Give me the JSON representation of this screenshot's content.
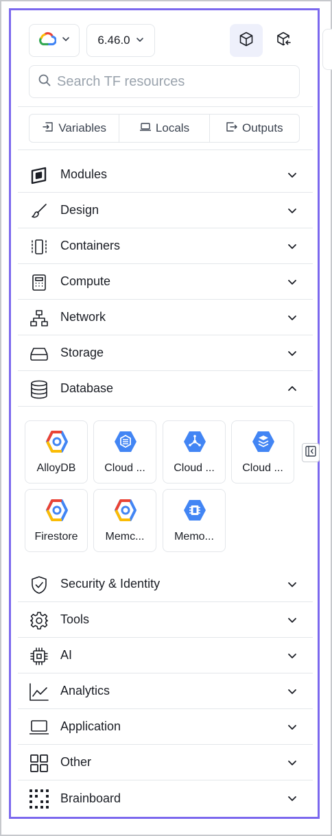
{
  "toolbar": {
    "provider": "google-cloud",
    "version": "6.46.0",
    "resources_view_icon": "cube-icon",
    "import_view_icon": "cube-import-icon"
  },
  "search": {
    "placeholder": "Search TF resources",
    "value": ""
  },
  "tabs": [
    {
      "label": "Variables",
      "icon": "variables-icon"
    },
    {
      "label": "Locals",
      "icon": "laptop-icon"
    },
    {
      "label": "Outputs",
      "icon": "outputs-icon"
    }
  ],
  "categories": [
    {
      "label": "Modules",
      "icon": "modules-icon",
      "expanded": false
    },
    {
      "label": "Design",
      "icon": "brush-icon",
      "expanded": false
    },
    {
      "label": "Containers",
      "icon": "containers-icon",
      "expanded": false
    },
    {
      "label": "Compute",
      "icon": "compute-icon",
      "expanded": false
    },
    {
      "label": "Network",
      "icon": "network-icon",
      "expanded": false
    },
    {
      "label": "Storage",
      "icon": "storage-icon",
      "expanded": false
    },
    {
      "label": "Database",
      "icon": "database-icon",
      "expanded": true
    },
    {
      "label": "Security & Identity",
      "icon": "shield-icon",
      "expanded": false
    },
    {
      "label": "Tools",
      "icon": "gear-icon",
      "expanded": false
    },
    {
      "label": "AI",
      "icon": "chip-icon",
      "expanded": false
    },
    {
      "label": "Analytics",
      "icon": "chart-icon",
      "expanded": false
    },
    {
      "label": "Application",
      "icon": "laptop-icon",
      "expanded": false
    },
    {
      "label": "Other",
      "icon": "grid-icon",
      "expanded": false
    },
    {
      "label": "Brainboard",
      "icon": "dots-grid-icon",
      "expanded": false
    }
  ],
  "database_resources": [
    {
      "label": "AlloyDB",
      "icon": "gcp-hexagon-icon"
    },
    {
      "label": "Cloud ...",
      "icon": "cloud-sql-icon"
    },
    {
      "label": "Cloud ...",
      "icon": "cloud-spanner-icon"
    },
    {
      "label": "Cloud ...",
      "icon": "cloud-bigtable-icon"
    },
    {
      "label": "Firestore",
      "icon": "gcp-hexagon-icon"
    },
    {
      "label": "Memc...",
      "icon": "gcp-hexagon-icon"
    },
    {
      "label": "Memo...",
      "icon": "memorystore-icon"
    }
  ],
  "colors": {
    "accent": "#7b68ee",
    "border": "#e3e6ea",
    "gcp_blue": "#4285f4",
    "gcp_red": "#ea4335",
    "gcp_yellow": "#fbbc04",
    "gcp_green": "#34a853"
  }
}
